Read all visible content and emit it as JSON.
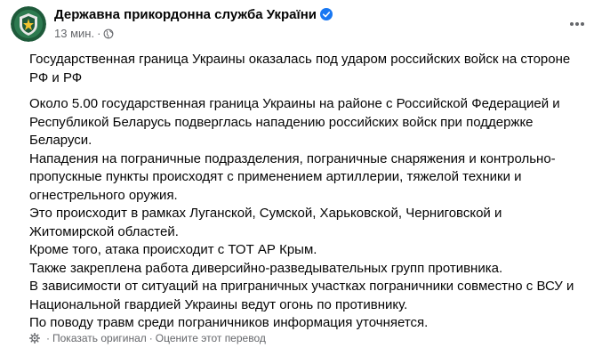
{
  "post": {
    "author": "Державна прикордонна служба України",
    "time": "13 мин.",
    "dot": "·",
    "lead": "Государственная граница Украины оказалась под ударом российских войск на стороне РФ и РФ",
    "paragraphs": [
      "Около 5.00 государственная граница Украины на районе с Российской Федерацией и Республикой Беларусь подверглась нападению российских войск при поддержке Беларуси.",
      "Нападения на пограничные подразделения, пограничные снаряжения и контрольно-пропускные пункты происходят с применением артиллерии, тяжелой техники и огнестрельного оружия.",
      "Это происходит в рамках Луганской, Сумской, Харьковской, Черниговской и Житомирской областей.",
      "Кроме того, атака происходит с ТОТ АР Крым.",
      "Также закреплена работа диверсийно-разведывательных групп противника.",
      "В зависимости от ситуаций на приграничных участках пограничники совместно с ВСУ и Национальной гвардией Украины ведут огонь по противнику.",
      "По поводу травм среди пограничников информация уточняется."
    ]
  },
  "translation": {
    "show_original": "Показать оригинал",
    "separator": "·",
    "rate": "Оцените этот перевод"
  },
  "icons": {
    "verified": "verified-badge-icon",
    "privacy": "globe-icon",
    "more": "more-options-icon",
    "translation_settings": "gear-icon"
  },
  "colors": {
    "text": "#050505",
    "secondary": "#65676b",
    "verified": "#1877f2",
    "avatar_bg": "#1e5a3a"
  }
}
